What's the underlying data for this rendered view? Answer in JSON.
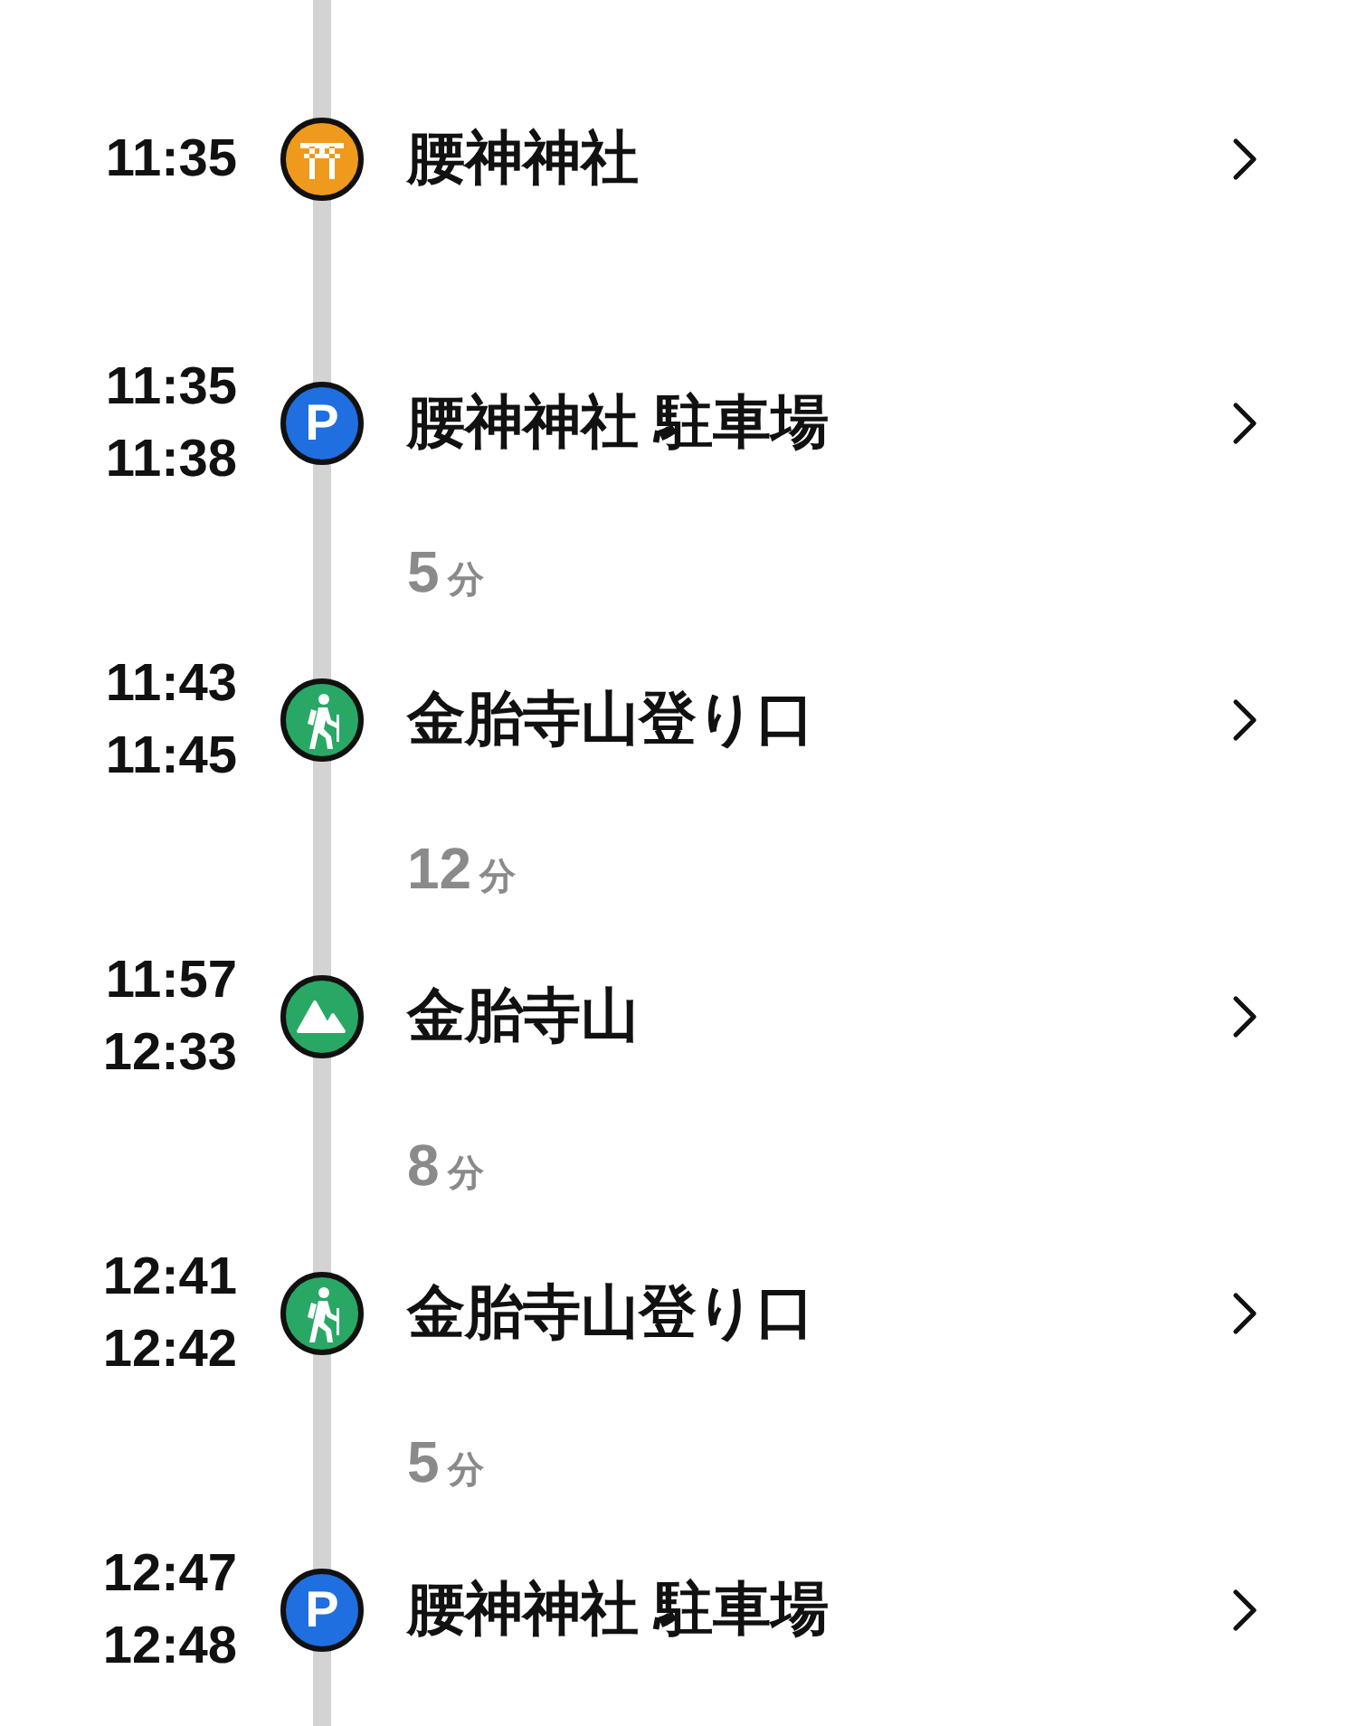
{
  "items": [
    {
      "kind": "shrine",
      "times": [
        "11:35"
      ],
      "name": "腰神神社"
    },
    {
      "kind": "parking",
      "badge": "P",
      "times": [
        "11:35",
        "11:38"
      ],
      "name": "腰神神社 駐車場"
    },
    {
      "kind": "duration",
      "value": "5",
      "unit": "分"
    },
    {
      "kind": "trailhead",
      "times": [
        "11:43",
        "11:45"
      ],
      "name": "金胎寺山登り口"
    },
    {
      "kind": "duration",
      "value": "12",
      "unit": "分"
    },
    {
      "kind": "summit",
      "times": [
        "11:57",
        "12:33"
      ],
      "name": "金胎寺山"
    },
    {
      "kind": "duration",
      "value": "8",
      "unit": "分"
    },
    {
      "kind": "trailhead",
      "times": [
        "12:41",
        "12:42"
      ],
      "name": "金胎寺山登り口"
    },
    {
      "kind": "duration",
      "value": "5",
      "unit": "分"
    },
    {
      "kind": "parking",
      "badge": "P",
      "times": [
        "12:47",
        "12:48"
      ],
      "name": "腰神神社 駐車場"
    }
  ]
}
